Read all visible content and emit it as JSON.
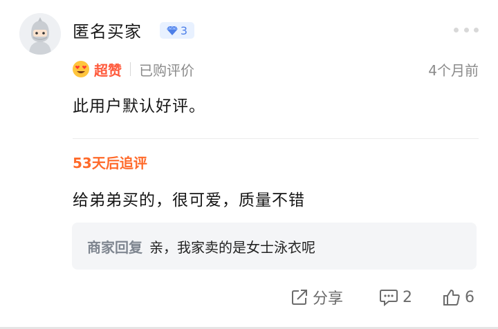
{
  "user": {
    "name": "匿名买家",
    "level": "3",
    "avatar_icon": "ninja-avatar-icon"
  },
  "rating": {
    "label": "超赞",
    "purchase_tag": "已购评价",
    "time": "4个月前",
    "accent": "#ff5a3c"
  },
  "review": {
    "text": "此用户默认好评。"
  },
  "followup": {
    "title": "53天后追评",
    "text": "给弟弟买的，很可爱，质量不错",
    "accent": "#ff6a2a"
  },
  "merchant_reply": {
    "label": "商家回复",
    "text": "亲，我家卖的是女士泳衣呢"
  },
  "actions": {
    "share_label": "分享",
    "comment_count": "2",
    "like_count": "6"
  }
}
